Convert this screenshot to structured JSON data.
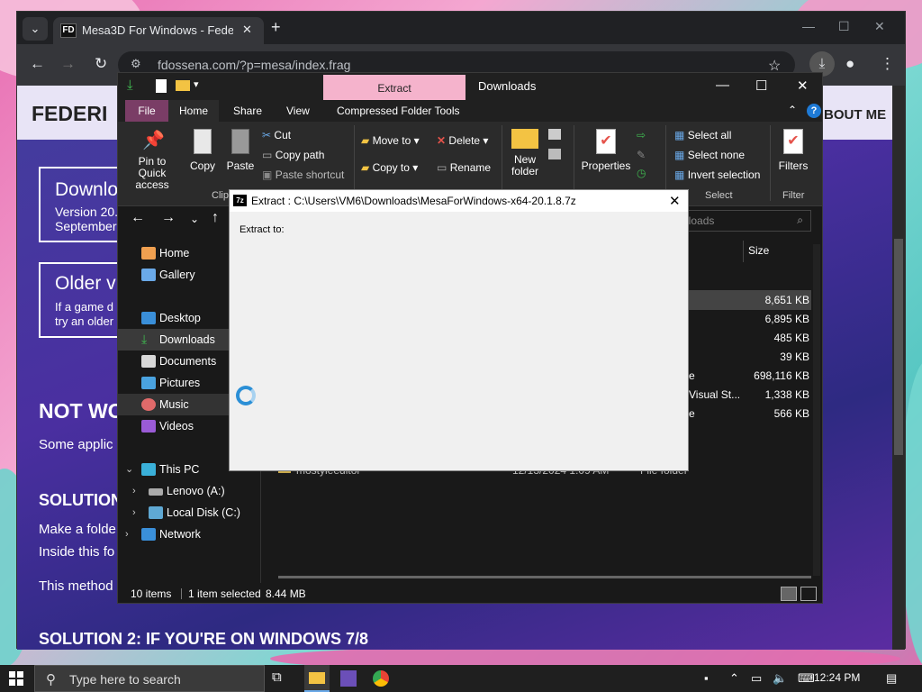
{
  "chrome": {
    "tab_favicon": "FD",
    "tab_title": "Mesa3D For Windows - Federico",
    "url": "fdossena.com/?p=mesa/index.frag"
  },
  "webpage": {
    "brand": "FEDERI",
    "about": "BOUT ME",
    "card1_title": "Downlo",
    "card1_line1": "Version 20.",
    "card1_line2": "September",
    "card2_title": "Older v",
    "card2_line1": "If a game d",
    "card2_line2": "try an older",
    "heading_not": "NOT WO",
    "some_applic": "Some applic",
    "solution1": "SOLUTION",
    "make_folder": "Make a folde",
    "inside_this": "Inside this fo",
    "this_method": "This method",
    "solution2": "SOLUTION 2: IF YOU'RE ON WINDOWS 7/8"
  },
  "explorer": {
    "context_tab": "Extract",
    "title": "Downloads",
    "ribbon_tabs": [
      "File",
      "Home",
      "Share",
      "View",
      "Compressed Folder Tools"
    ],
    "clipboard": {
      "pin": "Pin to Quick access",
      "copy": "Copy",
      "paste": "Paste",
      "cut": "Cut",
      "copy_path": "Copy path",
      "paste_shortcut": "Paste shortcut",
      "group": "Clip"
    },
    "organize": {
      "move_to": "Move to",
      "copy_to": "Copy to",
      "delete": "Delete",
      "rename": "Rename"
    },
    "new_folder": "New folder",
    "properties": "Properties",
    "select": {
      "select_all": "Select all",
      "select_none": "Select none",
      "invert": "Invert selection",
      "group": "Select"
    },
    "filters": "Filters",
    "filter_group": "Filter",
    "search_placeholder": "nloads",
    "nav": [
      {
        "label": "Home"
      },
      {
        "label": "Gallery"
      },
      {
        "label": "Desktop"
      },
      {
        "label": "Downloads"
      },
      {
        "label": "Documents"
      },
      {
        "label": "Pictures"
      },
      {
        "label": "Music"
      },
      {
        "label": "Videos"
      },
      {
        "label": "This PC"
      },
      {
        "label": "Lenovo (A:)"
      },
      {
        "label": "Local Disk (C:)"
      },
      {
        "label": "Network"
      }
    ],
    "column_size": "Size",
    "sizes": [
      "8,651 KB",
      "6,895 KB",
      "485 KB",
      "39 KB",
      "698,116 KB",
      "1,338 KB",
      "566 KB"
    ],
    "type_fragments": [
      "e",
      "Visual St...",
      "e"
    ],
    "partial_row": "mostyleeditor",
    "partial_date": "12/13/2024 1:09 AM",
    "partial_type": "File folder",
    "status_items": "10 items",
    "status_selected": "1 item selected",
    "status_size": "8.44 MB"
  },
  "dialog": {
    "title": "Extract : C:\\Users\\VM6\\Downloads\\MesaForWindows-x64-20.1.8.7z",
    "icon": "7z",
    "label": "Extract to:"
  },
  "taskbar": {
    "search_placeholder": "Type here to search",
    "time": "12:24 PM"
  }
}
